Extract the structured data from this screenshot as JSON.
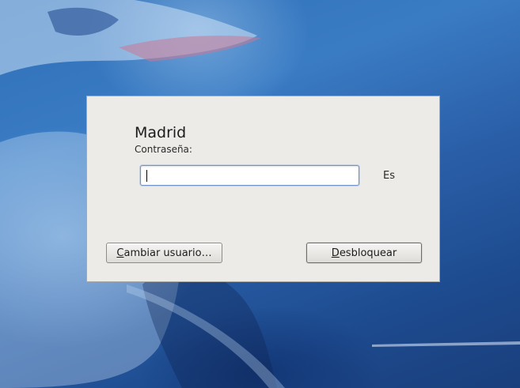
{
  "lock_dialog": {
    "user_name": "Madrid",
    "password_label": "Contraseña:",
    "password_value": "",
    "keyboard_layout": "Es",
    "switch_user_button": {
      "mnemonic": "C",
      "rest": "ambiar usuario…"
    },
    "unlock_button": {
      "mnemonic": "D",
      "rest": "esbloquear"
    }
  },
  "colors": {
    "dialog_background": "#edebe7",
    "input_focus_border": "#6f95c9",
    "wallpaper_blue": "#2a5fa8"
  },
  "icons": {
    "wallpaper": "penguin-wallpaper"
  }
}
